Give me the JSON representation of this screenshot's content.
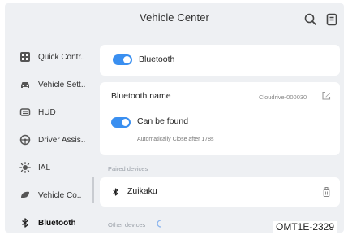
{
  "header": {
    "title": "Vehicle Center",
    "icons": [
      "search-icon",
      "notes-icon"
    ]
  },
  "sidebar": {
    "items": [
      {
        "label": "Quick Contr..",
        "icon": "quick-control-icon"
      },
      {
        "label": "Vehicle Sett..",
        "icon": "car-icon"
      },
      {
        "label": "HUD",
        "icon": "hud-icon"
      },
      {
        "label": "Driver Assis..",
        "icon": "steering-wheel-icon"
      },
      {
        "label": "IAL",
        "icon": "light-icon"
      },
      {
        "label": "Vehicle Co..",
        "icon": "vehicle-comfort-icon"
      },
      {
        "label": "Bluetooth",
        "icon": "bluetooth-icon",
        "active": true
      }
    ]
  },
  "bluetooth": {
    "label": "Bluetooth",
    "enabled": true
  },
  "bluetooth_name": {
    "label": "Bluetooth name",
    "value": "Cloudrive-000030",
    "edit_icon": "edit-icon"
  },
  "discoverable": {
    "label": "Can be found",
    "enabled": true,
    "hint": "Automatically Close after 178s"
  },
  "paired": {
    "section_label": "Paired devices",
    "devices": [
      {
        "name": "Zuikaku",
        "icon": "bluetooth-icon",
        "action_icon": "trash-icon"
      }
    ]
  },
  "other": {
    "section_label": "Other devices",
    "loading_icon": "spinner-icon"
  },
  "watermark": "OMT1E-2329",
  "colors": {
    "accent": "#3a8ff0",
    "background": "#eef0f3",
    "card": "#ffffff"
  }
}
